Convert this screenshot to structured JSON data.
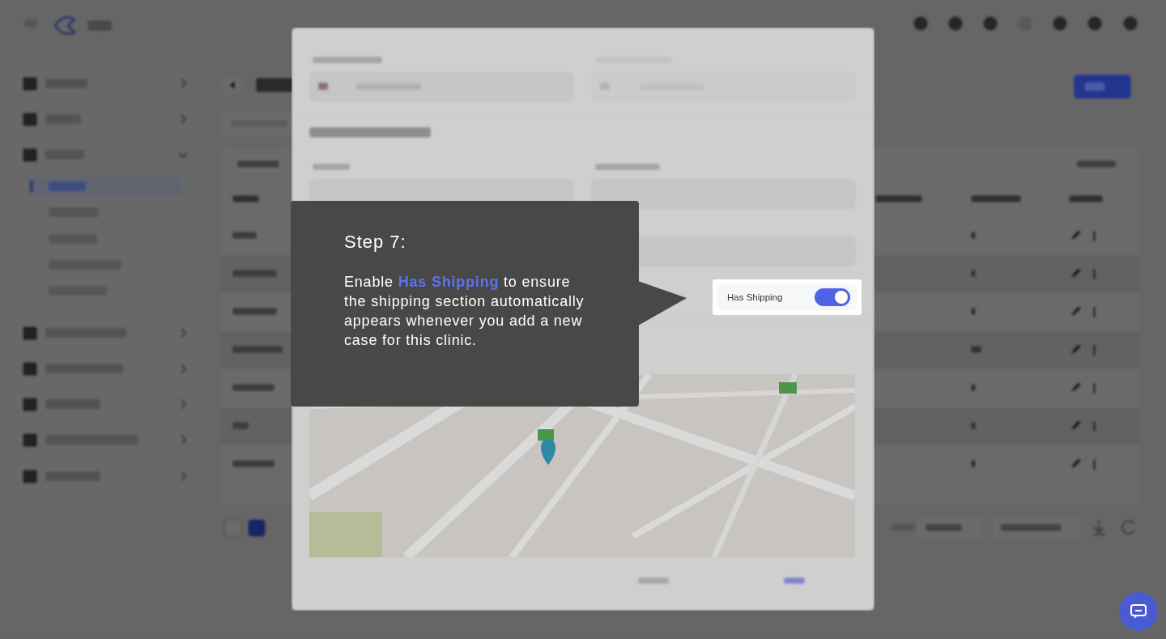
{
  "has_shipping": {
    "label": "Has Shipping",
    "on": true
  },
  "tour": {
    "title": "Step 7:",
    "body": "Enable **Has Shipping** to ensure the shipping section automatically appears whenever you add a new case for this clinic."
  }
}
